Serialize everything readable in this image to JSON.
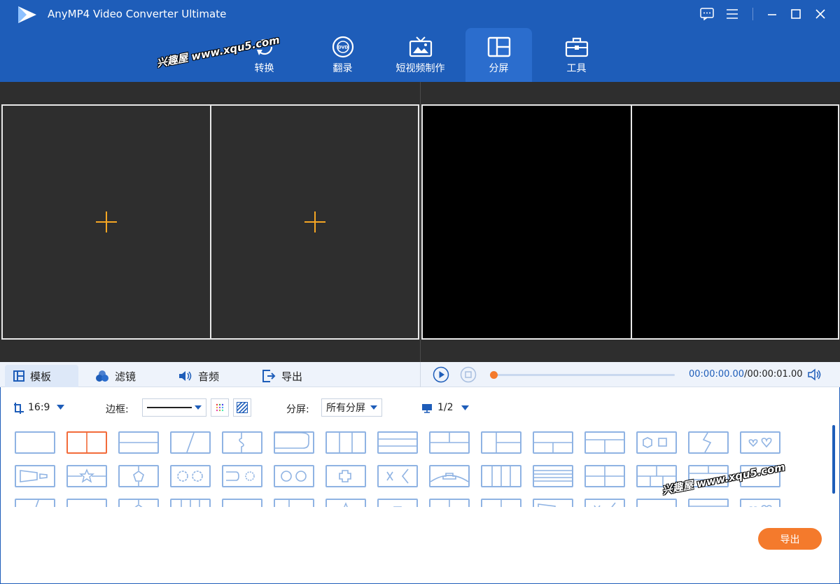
{
  "app": {
    "title": "AnyMP4 Video Converter Ultimate"
  },
  "nav": {
    "tabs": [
      {
        "label": "转换",
        "icon": "convert-icon"
      },
      {
        "label": "翻录",
        "icon": "dvd-icon"
      },
      {
        "label": "短视频制作",
        "icon": "tv-icon"
      },
      {
        "label": "分屏",
        "icon": "split-screen-icon",
        "active": true
      },
      {
        "label": "工具",
        "icon": "toolbox-icon"
      }
    ]
  },
  "watermark": {
    "text": "兴趣屋 www.xqu5.com"
  },
  "bottom_tabs": [
    {
      "label": "模板",
      "icon": "template-icon",
      "active": true
    },
    {
      "label": "滤镜",
      "icon": "filter-icon"
    },
    {
      "label": "音频",
      "icon": "audio-icon"
    },
    {
      "label": "导出",
      "icon": "export-icon"
    }
  ],
  "player": {
    "current_time": "00:00:00.00",
    "total_time": "/00:00:01.00",
    "progress": 0.0
  },
  "options": {
    "aspect_ratio": "16:9",
    "border_label": "边框:",
    "split_label": "分屏:",
    "split_value": "所有分屏",
    "page": "1/2"
  },
  "templates": {
    "selected_index": 1
  },
  "export": {
    "label": "导出"
  },
  "colors": {
    "brand": "#1e5db9",
    "accent": "#f47a2c",
    "template_border": "#8fb3e3",
    "selected": "#f26b3a"
  }
}
